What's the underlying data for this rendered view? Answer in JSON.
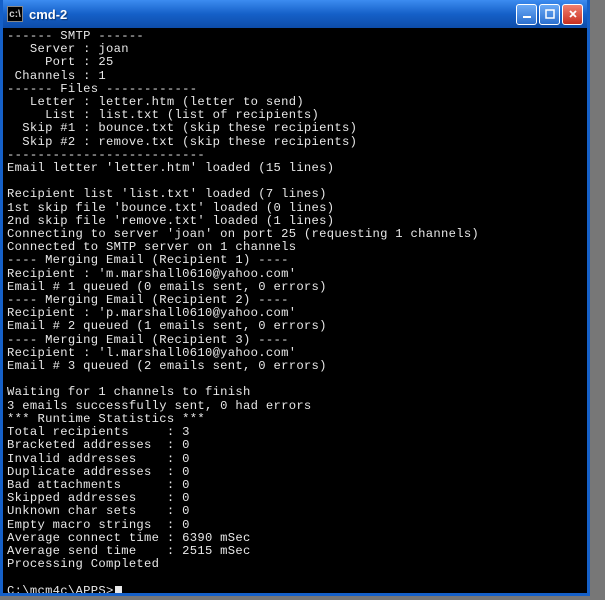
{
  "window": {
    "app_icon_glyph": "c:\\",
    "title": "cmd-2",
    "controls": {
      "minimize_label": "Minimize",
      "maximize_label": "Maximize",
      "close_label": "Close"
    }
  },
  "terminal": {
    "lines": [
      "------ SMTP ------",
      "   Server : joan",
      "     Port : 25",
      " Channels : 1",
      "------ Files ------------",
      "   Letter : letter.htm (letter to send)",
      "     List : list.txt (list of recipients)",
      "  Skip #1 : bounce.txt (skip these recipients)",
      "  Skip #2 : remove.txt (skip these recipients)",
      "--------------------------",
      "Email letter 'letter.htm' loaded (15 lines)",
      "",
      "Recipient list 'list.txt' loaded (7 lines)",
      "1st skip file 'bounce.txt' loaded (0 lines)",
      "2nd skip file 'remove.txt' loaded (1 lines)",
      "Connecting to server 'joan' on port 25 (requesting 1 channels)",
      "Connected to SMTP server on 1 channels",
      "---- Merging Email (Recipient 1) ----",
      "Recipient : 'm.marshall0610@yahoo.com'",
      "Email # 1 queued (0 emails sent, 0 errors)",
      "---- Merging Email (Recipient 2) ----",
      "Recipient : 'p.marshall0610@yahoo.com'",
      "Email # 2 queued (1 emails sent, 0 errors)",
      "---- Merging Email (Recipient 3) ----",
      "Recipient : 'l.marshall0610@yahoo.com'",
      "Email # 3 queued (2 emails sent, 0 errors)",
      "",
      "Waiting for 1 channels to finish",
      "3 emails successfully sent, 0 had errors",
      "*** Runtime Statistics ***",
      "Total recipients     : 3",
      "Bracketed addresses  : 0",
      "Invalid addresses    : 0",
      "Duplicate addresses  : 0",
      "Bad attachments      : 0",
      "Skipped addresses    : 0",
      "Unknown char sets    : 0",
      "Empty macro strings  : 0",
      "Average connect time : 6390 mSec",
      "Average send time    : 2515 mSec",
      "Processing Completed",
      ""
    ],
    "prompt": "C:\\mcm4c\\APPS>"
  }
}
